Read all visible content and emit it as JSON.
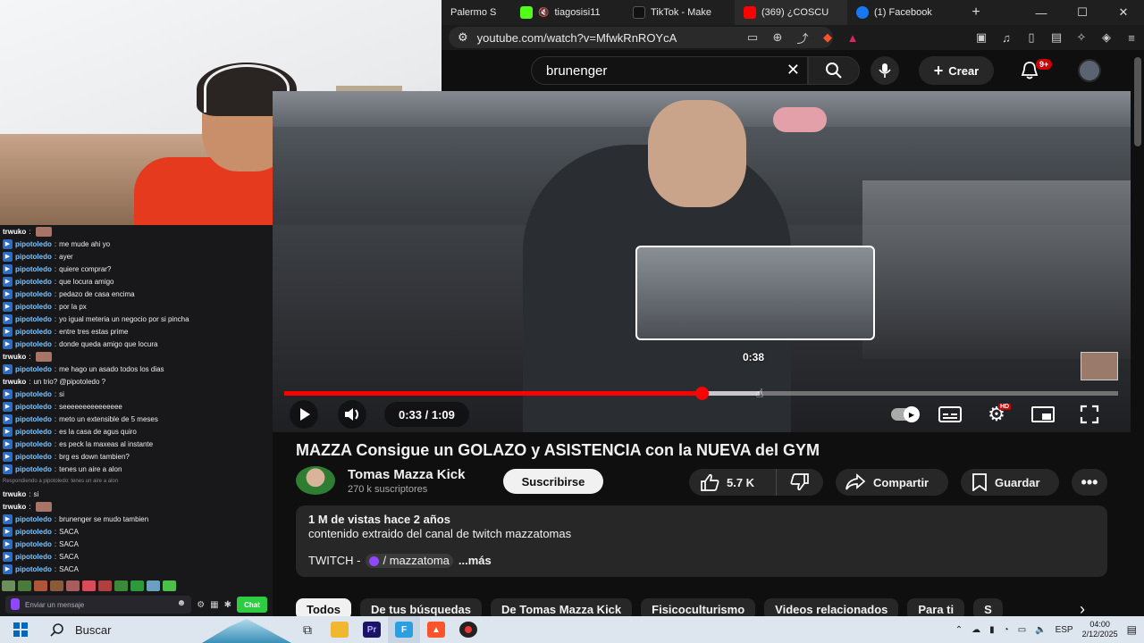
{
  "browser": {
    "tabs": [
      {
        "label": "Palermo S",
        "color": "#444444"
      },
      {
        "label": "tiagosisi11",
        "color": "#53fc18",
        "muted": "🔇"
      },
      {
        "label": "TikTok - Make",
        "color": "#111111"
      },
      {
        "label": "(369) ¿COSCU",
        "color": "#ff0000"
      },
      {
        "label": "(1) Facebook",
        "color": "#1877f2"
      }
    ],
    "new_tab": "+",
    "url": "youtube.com/watch?v=MfwkRnROYcA",
    "window_controls": {
      "minimize": "—",
      "maximize": "☐",
      "close": "✕"
    }
  },
  "youtube": {
    "search_query": "brunenger",
    "create_label": "Crear",
    "notification_count": "9+"
  },
  "chat": {
    "messages": [
      {
        "user": "trwuko",
        "text": "",
        "emote": true,
        "color": "#ffffff",
        "badge": false
      },
      {
        "user": "pipotoledo",
        "text": "me mude ahi yo",
        "color": "#7cc5ff",
        "badge": true
      },
      {
        "user": "pipotoledo",
        "text": "ayer",
        "color": "#7cc5ff",
        "badge": true
      },
      {
        "user": "pipotoledo",
        "text": "quiere comprar?",
        "color": "#7cc5ff",
        "badge": true
      },
      {
        "user": "pipotoledo",
        "text": "que locura amigo",
        "color": "#7cc5ff",
        "badge": true
      },
      {
        "user": "pipotoledo",
        "text": "pedazo de casa encima",
        "color": "#7cc5ff",
        "badge": true
      },
      {
        "user": "pipotoledo",
        "text": "por la px",
        "color": "#7cc5ff",
        "badge": true
      },
      {
        "user": "pipotoledo",
        "text": "yo igual meteria un negocio por si pincha",
        "color": "#7cc5ff",
        "badge": true
      },
      {
        "user": "pipotoledo",
        "text": "entre tres estas prime",
        "color": "#7cc5ff",
        "badge": true
      },
      {
        "user": "pipotoledo",
        "text": "donde queda amigo que locura",
        "color": "#7cc5ff",
        "badge": true
      },
      {
        "user": "trwuko",
        "text": "",
        "emote": true,
        "color": "#ffffff",
        "badge": false
      },
      {
        "user": "pipotoledo",
        "text": "me hago un asado todos los dias",
        "color": "#7cc5ff",
        "badge": true
      },
      {
        "user": "trwuko",
        "text": "un trio? @pipotoledo ?",
        "color": "#ffffff",
        "badge": false
      },
      {
        "user": "pipotoledo",
        "text": "si",
        "color": "#7cc5ff",
        "badge": true
      },
      {
        "user": "pipotoledo",
        "text": "seeeeeeeeeeeeeee",
        "color": "#7cc5ff",
        "badge": true
      },
      {
        "user": "pipotoledo",
        "text": "meto un extensible de 5 meses",
        "color": "#7cc5ff",
        "badge": true
      },
      {
        "user": "pipotoledo",
        "text": "es la casa de agus quiro",
        "color": "#7cc5ff",
        "badge": true
      },
      {
        "user": "pipotoledo",
        "text": "es peck la maxeas al instante",
        "color": "#7cc5ff",
        "badge": true
      },
      {
        "user": "pipotoledo",
        "text": "brg es down tambien?",
        "color": "#7cc5ff",
        "badge": true
      },
      {
        "user": "pipotoledo",
        "text": "tenes un aire a alon",
        "color": "#7cc5ff",
        "badge": true
      },
      {
        "user": "",
        "text": "Respondiendo a pipotoledo: tenes un aire a alon",
        "color": "#8a8a8f",
        "badge": false,
        "reply": true
      },
      {
        "user": "trwuko",
        "text": "si",
        "color": "#ffffff",
        "badge": false
      },
      {
        "user": "trwuko",
        "text": "",
        "emote": true,
        "color": "#ffffff",
        "badge": false
      },
      {
        "user": "pipotoledo",
        "text": "brunenger se mudo tambien",
        "color": "#7cc5ff",
        "badge": true
      },
      {
        "user": "pipotoledo",
        "text": "SACA",
        "color": "#7cc5ff",
        "badge": true
      },
      {
        "user": "pipotoledo",
        "text": "SACA",
        "color": "#7cc5ff",
        "badge": true
      },
      {
        "user": "pipotoledo",
        "text": "SACA",
        "color": "#7cc5ff",
        "badge": true
      },
      {
        "user": "pipotoledo",
        "text": "SACA",
        "color": "#7cc5ff",
        "badge": true
      }
    ],
    "emote_colors": [
      "#6a8f5a",
      "#4c7a3b",
      "#b0553a",
      "#8a5a3a",
      "#a85c5c",
      "#d94a5a",
      "#b04040",
      "#3a8a3a",
      "#2a9a3a",
      "#6aa0c0",
      "#4ac04a"
    ],
    "input_placeholder": "Enviar un mensaje",
    "chat_button": "Chat"
  },
  "player": {
    "current_time": "0:33",
    "duration": "1:09",
    "hover_time": "0:38",
    "progress_fraction": 0.5,
    "buffer_fraction": 0.57,
    "hover_fraction": 0.57
  },
  "video": {
    "title": "MAZZA Consigue un GOLAZO y ASISTENCIA con la NUEVA del GYM",
    "channel": "Tomas Mazza Kick",
    "subscribers": "270 k suscriptores",
    "subscribe_label": "Suscribirse",
    "likes": "5.7 K",
    "share_label": "Compartir",
    "save_label": "Guardar",
    "views_line": "1 M de vistas  hace 2 años",
    "description": "contenido extraido del canal de twitch mazzatomas",
    "twitch_prefix": "TWITCH -",
    "twitch_link": "/ mazzatoma",
    "more_label": "...más"
  },
  "chips": [
    "Todos",
    "De tus búsquedas",
    "De Tomas Mazza Kick",
    "Fisicoculturismo",
    "Videos relacionados",
    "Para ti",
    "S"
  ],
  "taskbar": {
    "search_label": "Buscar",
    "language": "ESP",
    "time": "04:00",
    "date": "2/12/2025"
  }
}
